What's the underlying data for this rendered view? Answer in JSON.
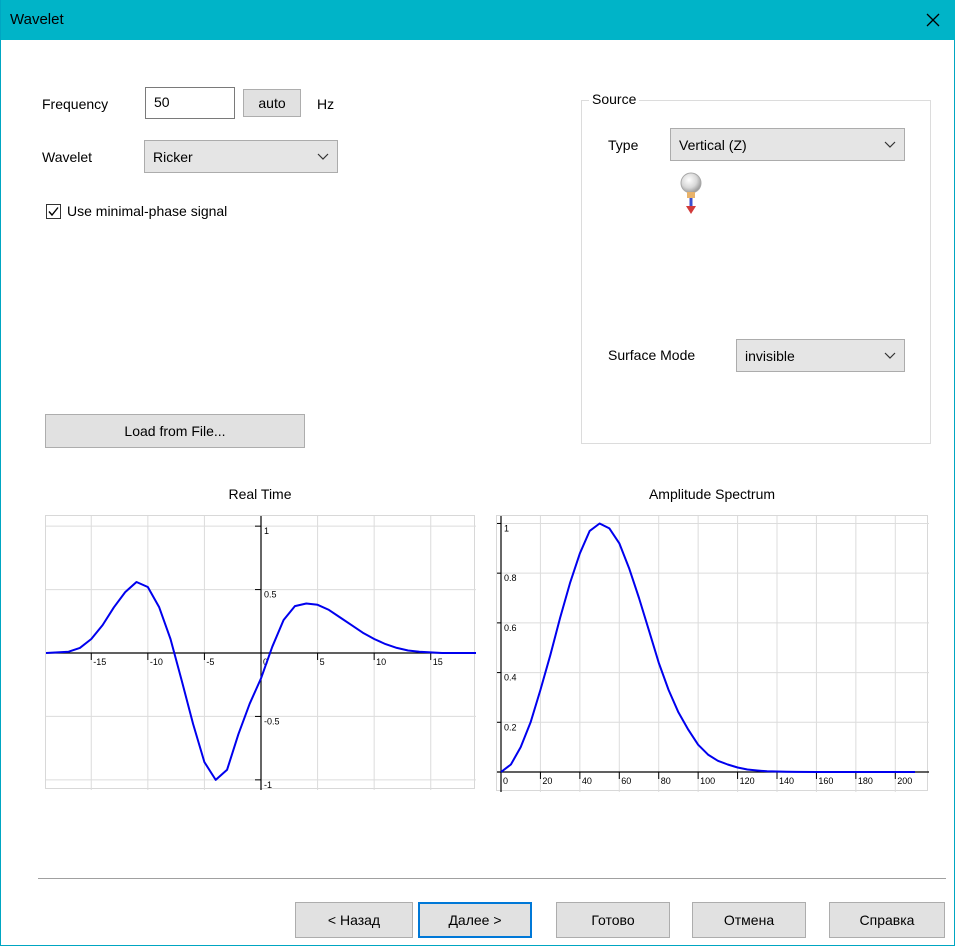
{
  "window": {
    "title": "Wavelet"
  },
  "frequency": {
    "label": "Frequency",
    "value": "50",
    "auto_label": "auto",
    "unit": "Hz"
  },
  "wavelet": {
    "label": "Wavelet",
    "selected": "Ricker"
  },
  "minimal_phase": {
    "label": "Use minimal-phase signal",
    "checked": true
  },
  "load_button": "Load from File...",
  "source": {
    "title": "Source",
    "type_label": "Type",
    "type_value": "Vertical (Z)",
    "surface_label": "Surface Mode",
    "surface_value": "invisible"
  },
  "footer": {
    "back": "< Назад",
    "next": "Далее >",
    "finish": "Готово",
    "cancel": "Отмена",
    "help": "Справка"
  },
  "chart_data": [
    {
      "type": "line",
      "title": "Real Time",
      "xlim": [
        -19,
        19
      ],
      "ylim": [
        -1.08,
        1.08
      ],
      "x_ticks": [
        -15,
        -10,
        -5,
        0,
        5,
        10,
        15
      ],
      "x_tick_labels": [
        "-15",
        "-10",
        "-5",
        "0",
        "5",
        "10",
        "15"
      ],
      "y_ticks": [
        1,
        0.5,
        -0.5,
        -1
      ],
      "y_tick_labels": [
        "1",
        "0.5",
        "-0.5",
        "-1"
      ],
      "grid": true,
      "color": "#0000ee",
      "series": [
        {
          "x": [
            -19,
            -17,
            -16,
            -15,
            -14,
            -13,
            -12,
            -11,
            -10,
            -9,
            -8,
            -7,
            -6,
            -5,
            -4,
            -3,
            -2,
            -1,
            0,
            1,
            2,
            3,
            4,
            5,
            6,
            7,
            8,
            9,
            10,
            11,
            12,
            13,
            14,
            15,
            16,
            17,
            19
          ],
          "y": [
            0,
            0.01,
            0.04,
            0.11,
            0.22,
            0.36,
            0.48,
            0.56,
            0.52,
            0.36,
            0.11,
            -0.22,
            -0.56,
            -0.86,
            -1,
            -0.92,
            -0.64,
            -0.4,
            -0.2,
            0.05,
            0.26,
            0.37,
            0.39,
            0.38,
            0.34,
            0.28,
            0.22,
            0.16,
            0.11,
            0.07,
            0.04,
            0.02,
            0.01,
            0.005,
            0,
            0,
            0
          ]
        }
      ]
    },
    {
      "type": "line",
      "title": "Amplitude Spectrum",
      "xlim": [
        0,
        210
      ],
      "ylim": [
        0,
        1.03
      ],
      "x_ticks": [
        0,
        20,
        40,
        60,
        80,
        100,
        120,
        140,
        160,
        180,
        200
      ],
      "x_tick_labels": [
        "0",
        "20",
        "40",
        "60",
        "80",
        "100",
        "120",
        "140",
        "160",
        "180",
        "200"
      ],
      "y_ticks": [
        0.2,
        0.4,
        0.6,
        0.8,
        1
      ],
      "y_tick_labels": [
        "0.2",
        "0.4",
        "0.6",
        "0.8",
        "1"
      ],
      "grid": true,
      "color": "#0000ee",
      "series": [
        {
          "x": [
            0,
            5,
            10,
            15,
            20,
            25,
            30,
            35,
            40,
            45,
            50,
            55,
            60,
            65,
            70,
            75,
            80,
            85,
            90,
            95,
            100,
            105,
            110,
            115,
            120,
            125,
            130,
            135,
            140,
            145,
            150,
            160,
            170,
            180,
            190,
            200,
            210
          ],
          "y": [
            0,
            0.03,
            0.1,
            0.2,
            0.33,
            0.47,
            0.62,
            0.76,
            0.88,
            0.97,
            1.0,
            0.98,
            0.92,
            0.82,
            0.7,
            0.57,
            0.44,
            0.33,
            0.24,
            0.17,
            0.11,
            0.07,
            0.045,
            0.03,
            0.018,
            0.01,
            0.006,
            0.003,
            0.002,
            0.001,
            0.0005,
            0,
            0,
            0,
            0,
            0,
            0
          ]
        }
      ]
    }
  ]
}
